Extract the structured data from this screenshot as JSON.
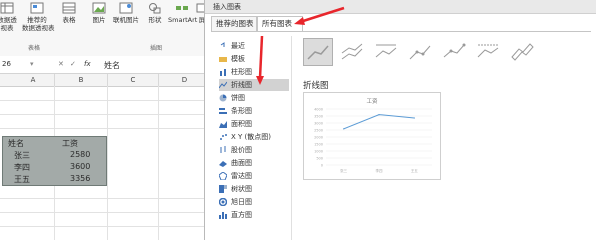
{
  "ribbon": {
    "buttons": [
      "数据透\n视表",
      "推荐的\n数据透视表",
      "表格",
      "图片",
      "联机图片",
      "形状",
      "SmartArt",
      "屏"
    ],
    "groups": [
      "表格",
      "插图"
    ]
  },
  "formula_bar": {
    "name_box": "26",
    "fx": "fx",
    "content": "姓名"
  },
  "sheet": {
    "columns": [
      "A",
      "B",
      "C",
      "D"
    ],
    "headers": [
      "姓名",
      "工资"
    ],
    "rows": [
      [
        "张三",
        "2580"
      ],
      [
        "李四",
        "3600"
      ],
      [
        "王五",
        "3356"
      ]
    ]
  },
  "dialog": {
    "title": "插入图表",
    "tabs": [
      "推荐的图表",
      "所有图表"
    ],
    "categories": [
      "最近",
      "模板",
      "柱形图",
      "折线图",
      "饼图",
      "条形图",
      "面积图",
      "X Y (散点图)",
      "股价图",
      "曲面图",
      "雷达图",
      "树状图",
      "旭日图",
      "直方图"
    ],
    "selected_category": "折线图",
    "section_title": "折线图",
    "preview_title": "工资"
  },
  "chart_data": {
    "type": "line",
    "title": "工资",
    "categories": [
      "张三",
      "李四",
      "王五"
    ],
    "series": [
      {
        "values": [
          2580,
          3600,
          3356
        ]
      }
    ],
    "ylim": [
      0,
      4000
    ]
  },
  "colors": {
    "accent_arrow": "#e8262c",
    "selection_fill": "#a3aaa8",
    "line": "#5b9bd5"
  }
}
